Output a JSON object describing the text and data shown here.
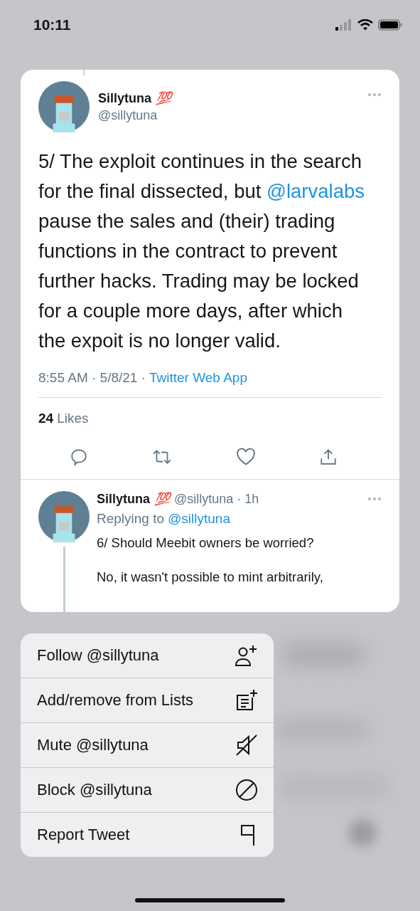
{
  "status_bar": {
    "time": "10:11"
  },
  "tweet": {
    "name": "Sillytuna",
    "badge": "💯",
    "handle": "@sillytuna",
    "text_parts": [
      {
        "kind": "plain",
        "text": "5/ The exploit continues in the search for the final dissected, but "
      },
      {
        "kind": "mention",
        "text": "@larvalabs"
      },
      {
        "kind": "plain",
        "text": " pause the sales and (their) trading functions in the contract to prevent further hacks. Trading may be locked for a couple more days, after which the expoit is no longer valid."
      }
    ],
    "time": "8:55 AM · 5/8/21 · ",
    "source": "Twitter Web App",
    "likes_count": "24",
    "likes_label": "Likes"
  },
  "reply": {
    "name": "Sillytuna",
    "badge": "💯",
    "handle": "@sillytuna · 1h",
    "replying_label": "Replying to",
    "replying_to": "@sillytuna",
    "paragraphs": [
      "6/ Should Meebit owners be worried?",
      "No, it wasn't possible to mint arbitrarily,"
    ]
  },
  "menu": [
    {
      "label": "Follow @sillytuna",
      "kind": "follow"
    },
    {
      "label": "Add/remove from Lists",
      "kind": "lists"
    },
    {
      "label": "Mute @sillytuna",
      "kind": "mute"
    },
    {
      "label": "Block @sillytuna",
      "kind": "block"
    },
    {
      "label": "Report Tweet",
      "kind": "report"
    }
  ]
}
